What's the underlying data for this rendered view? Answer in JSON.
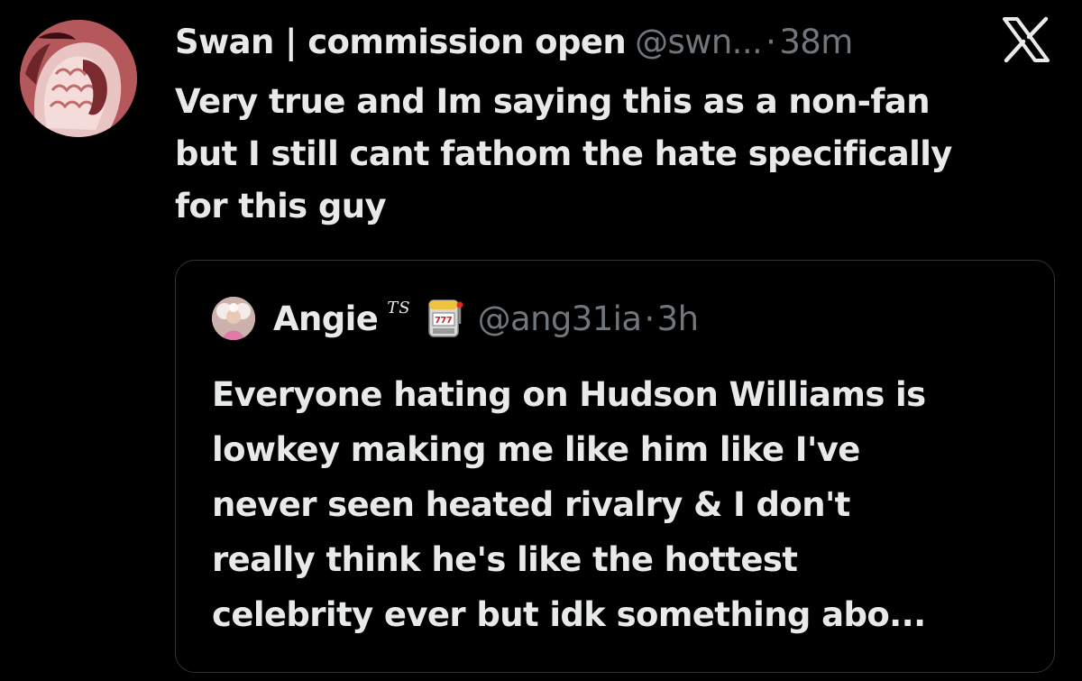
{
  "post": {
    "author": {
      "display_name": "Swan | commission open",
      "handle": "@swn...",
      "separator": "·",
      "time": "38m"
    },
    "text_lines": [
      "Very true and Im saying this as a non-fan",
      "but I still cant fathom the hate specifically",
      "for this guy"
    ],
    "logo_icon": "x-logo-icon"
  },
  "quote": {
    "author": {
      "display_name": "Angie",
      "tag": "TS",
      "emoji_icon": "slot-machine-icon",
      "handle": "@ang31ia",
      "separator": "·",
      "time": "3h"
    },
    "text_lines": [
      "Everyone hating on Hudson Williams is",
      "lowkey making me like him like I've",
      "never seen heated rivalry & I don't",
      "really think he's like the hottest",
      "celebrity ever but idk something abo..."
    ]
  },
  "colors": {
    "background": "#000000",
    "text_primary": "#e7e9ea",
    "text_secondary": "#71767b",
    "border": "#2f3336"
  }
}
